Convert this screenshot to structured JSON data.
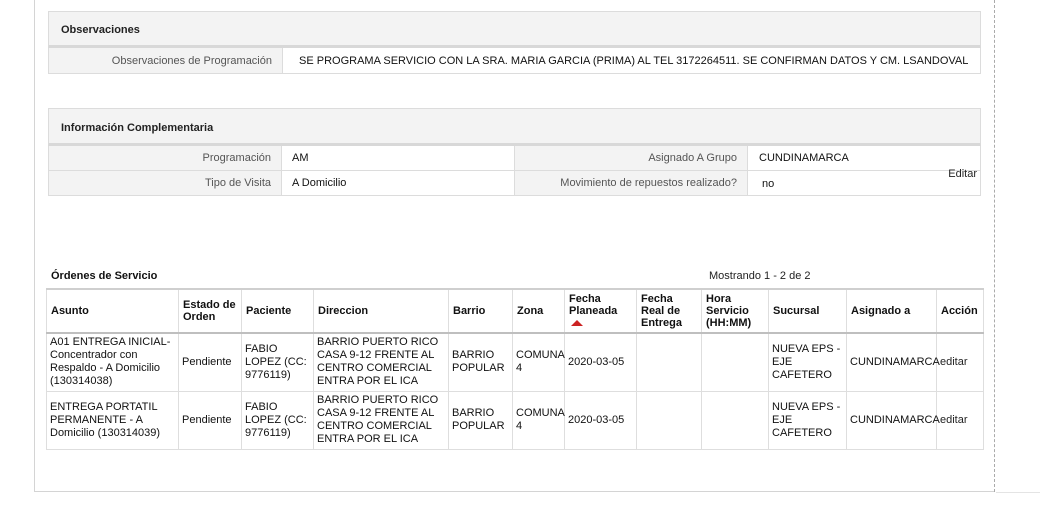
{
  "observaciones": {
    "title": "Observaciones",
    "label": "Observaciones de Programación",
    "value": "SE PROGRAMA SERVICIO CON LA SRA. MARIA GARCIA (PRIMA) AL TEL 3172264511. SE CONFIRMAN DATOS Y CM. LSANDOVAL"
  },
  "info": {
    "title": "Información Complementaria",
    "programacion_label": "Programación",
    "programacion_value": "AM",
    "grupo_label": "Asignado A Grupo",
    "grupo_value": "CUNDINAMARCA",
    "visita_label": "Tipo de Visita",
    "visita_value": "A Domicilio",
    "repuestos_label": "Movimiento de repuestos realizado?",
    "repuestos_value": "no",
    "edit_label": "Editar"
  },
  "orders": {
    "title": "Órdenes de Servicio",
    "count": "Mostrando 1 - 2 de 2",
    "headers": {
      "asunto": "Asunto",
      "estado": "Estado de Orden",
      "paciente": "Paciente",
      "direccion": "Direccion",
      "barrio": "Barrio",
      "zona": "Zona",
      "fecha_planeada": "Fecha Planeada",
      "fecha_real": "Fecha Real de Entrega",
      "hora": "Hora Servicio (HH:MM)",
      "sucursal": "Sucursal",
      "asignado": "Asignado a",
      "accion": "Acción"
    },
    "rows": [
      {
        "asunto": "A01 ENTREGA INICIAL-Concentrador con Respaldo - A Domicilio (130314038)",
        "estado": "Pendiente",
        "paciente": "FABIO LOPEZ (CC: 9776119)",
        "direccion": "BARRIO PUERTO RICO CASA 9-12 FRENTE AL CENTRO COMERCIAL ENTRA POR EL ICA",
        "barrio": "BARRIO POPULAR",
        "zona": "COMUNA 4",
        "fecha_planeada": "2020-03-05",
        "fecha_real": "",
        "hora": "",
        "sucursal": "NUEVA EPS - EJE CAFETERO",
        "asignado": "CUNDINAMARCA",
        "accion": "editar"
      },
      {
        "asunto": "ENTREGA PORTATIL PERMANENTE - A Domicilio (130314039)",
        "estado": "Pendiente",
        "paciente": "FABIO LOPEZ (CC: 9776119)",
        "direccion": "BARRIO PUERTO RICO CASA 9-12 FRENTE AL CENTRO COMERCIAL ENTRA POR EL ICA",
        "barrio": "BARRIO POPULAR",
        "zona": "COMUNA 4",
        "fecha_planeada": "2020-03-05",
        "fecha_real": "",
        "hora": "",
        "sucursal": "NUEVA EPS - EJE CAFETERO",
        "asignado": "CUNDINAMARCA",
        "accion": "editar"
      }
    ]
  },
  "colors": {
    "sort_arrow": "#cc2222",
    "panel_header_bg": "#f3f3f3"
  }
}
